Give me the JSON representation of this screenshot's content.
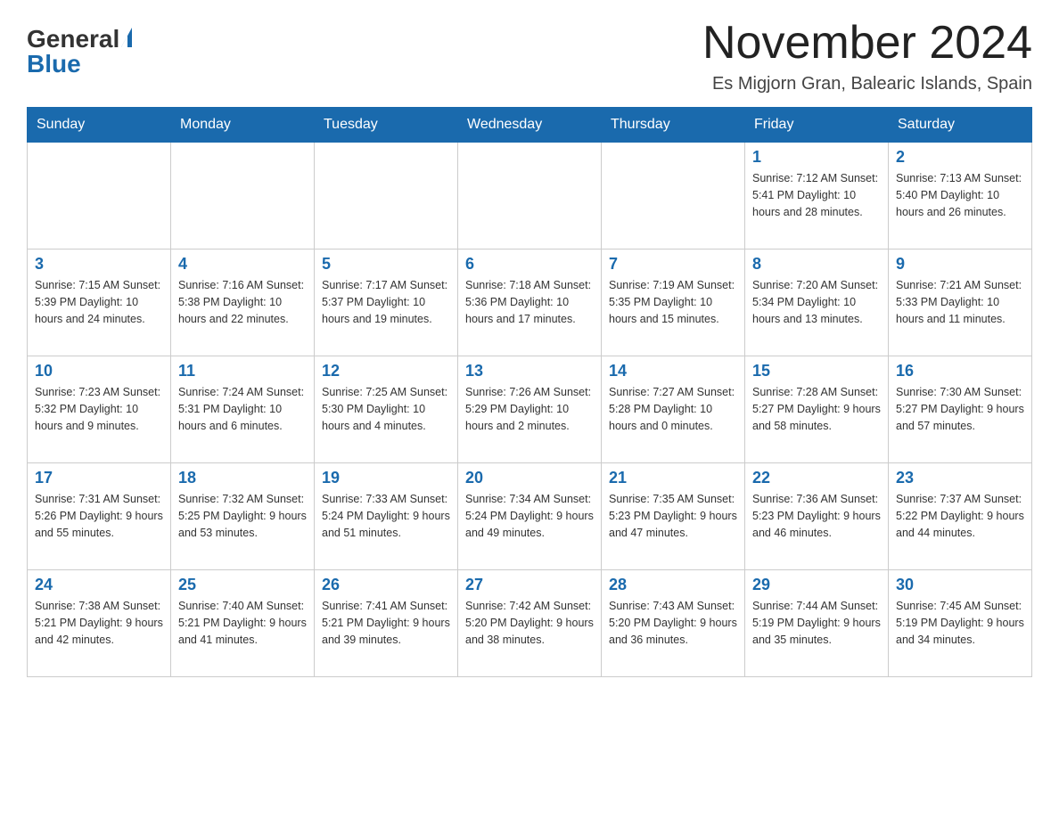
{
  "header": {
    "logo": {
      "general": "General",
      "blue": "Blue"
    },
    "title": "November 2024",
    "subtitle": "Es Migjorn Gran, Balearic Islands, Spain"
  },
  "calendar": {
    "days_of_week": [
      "Sunday",
      "Monday",
      "Tuesday",
      "Wednesday",
      "Thursday",
      "Friday",
      "Saturday"
    ],
    "weeks": [
      [
        {
          "day": "",
          "info": ""
        },
        {
          "day": "",
          "info": ""
        },
        {
          "day": "",
          "info": ""
        },
        {
          "day": "",
          "info": ""
        },
        {
          "day": "",
          "info": ""
        },
        {
          "day": "1",
          "info": "Sunrise: 7:12 AM\nSunset: 5:41 PM\nDaylight: 10 hours and 28 minutes."
        },
        {
          "day": "2",
          "info": "Sunrise: 7:13 AM\nSunset: 5:40 PM\nDaylight: 10 hours and 26 minutes."
        }
      ],
      [
        {
          "day": "3",
          "info": "Sunrise: 7:15 AM\nSunset: 5:39 PM\nDaylight: 10 hours and 24 minutes."
        },
        {
          "day": "4",
          "info": "Sunrise: 7:16 AM\nSunset: 5:38 PM\nDaylight: 10 hours and 22 minutes."
        },
        {
          "day": "5",
          "info": "Sunrise: 7:17 AM\nSunset: 5:37 PM\nDaylight: 10 hours and 19 minutes."
        },
        {
          "day": "6",
          "info": "Sunrise: 7:18 AM\nSunset: 5:36 PM\nDaylight: 10 hours and 17 minutes."
        },
        {
          "day": "7",
          "info": "Sunrise: 7:19 AM\nSunset: 5:35 PM\nDaylight: 10 hours and 15 minutes."
        },
        {
          "day": "8",
          "info": "Sunrise: 7:20 AM\nSunset: 5:34 PM\nDaylight: 10 hours and 13 minutes."
        },
        {
          "day": "9",
          "info": "Sunrise: 7:21 AM\nSunset: 5:33 PM\nDaylight: 10 hours and 11 minutes."
        }
      ],
      [
        {
          "day": "10",
          "info": "Sunrise: 7:23 AM\nSunset: 5:32 PM\nDaylight: 10 hours and 9 minutes."
        },
        {
          "day": "11",
          "info": "Sunrise: 7:24 AM\nSunset: 5:31 PM\nDaylight: 10 hours and 6 minutes."
        },
        {
          "day": "12",
          "info": "Sunrise: 7:25 AM\nSunset: 5:30 PM\nDaylight: 10 hours and 4 minutes."
        },
        {
          "day": "13",
          "info": "Sunrise: 7:26 AM\nSunset: 5:29 PM\nDaylight: 10 hours and 2 minutes."
        },
        {
          "day": "14",
          "info": "Sunrise: 7:27 AM\nSunset: 5:28 PM\nDaylight: 10 hours and 0 minutes."
        },
        {
          "day": "15",
          "info": "Sunrise: 7:28 AM\nSunset: 5:27 PM\nDaylight: 9 hours and 58 minutes."
        },
        {
          "day": "16",
          "info": "Sunrise: 7:30 AM\nSunset: 5:27 PM\nDaylight: 9 hours and 57 minutes."
        }
      ],
      [
        {
          "day": "17",
          "info": "Sunrise: 7:31 AM\nSunset: 5:26 PM\nDaylight: 9 hours and 55 minutes."
        },
        {
          "day": "18",
          "info": "Sunrise: 7:32 AM\nSunset: 5:25 PM\nDaylight: 9 hours and 53 minutes."
        },
        {
          "day": "19",
          "info": "Sunrise: 7:33 AM\nSunset: 5:24 PM\nDaylight: 9 hours and 51 minutes."
        },
        {
          "day": "20",
          "info": "Sunrise: 7:34 AM\nSunset: 5:24 PM\nDaylight: 9 hours and 49 minutes."
        },
        {
          "day": "21",
          "info": "Sunrise: 7:35 AM\nSunset: 5:23 PM\nDaylight: 9 hours and 47 minutes."
        },
        {
          "day": "22",
          "info": "Sunrise: 7:36 AM\nSunset: 5:23 PM\nDaylight: 9 hours and 46 minutes."
        },
        {
          "day": "23",
          "info": "Sunrise: 7:37 AM\nSunset: 5:22 PM\nDaylight: 9 hours and 44 minutes."
        }
      ],
      [
        {
          "day": "24",
          "info": "Sunrise: 7:38 AM\nSunset: 5:21 PM\nDaylight: 9 hours and 42 minutes."
        },
        {
          "day": "25",
          "info": "Sunrise: 7:40 AM\nSunset: 5:21 PM\nDaylight: 9 hours and 41 minutes."
        },
        {
          "day": "26",
          "info": "Sunrise: 7:41 AM\nSunset: 5:21 PM\nDaylight: 9 hours and 39 minutes."
        },
        {
          "day": "27",
          "info": "Sunrise: 7:42 AM\nSunset: 5:20 PM\nDaylight: 9 hours and 38 minutes."
        },
        {
          "day": "28",
          "info": "Sunrise: 7:43 AM\nSunset: 5:20 PM\nDaylight: 9 hours and 36 minutes."
        },
        {
          "day": "29",
          "info": "Sunrise: 7:44 AM\nSunset: 5:19 PM\nDaylight: 9 hours and 35 minutes."
        },
        {
          "day": "30",
          "info": "Sunrise: 7:45 AM\nSunset: 5:19 PM\nDaylight: 9 hours and 34 minutes."
        }
      ]
    ]
  }
}
